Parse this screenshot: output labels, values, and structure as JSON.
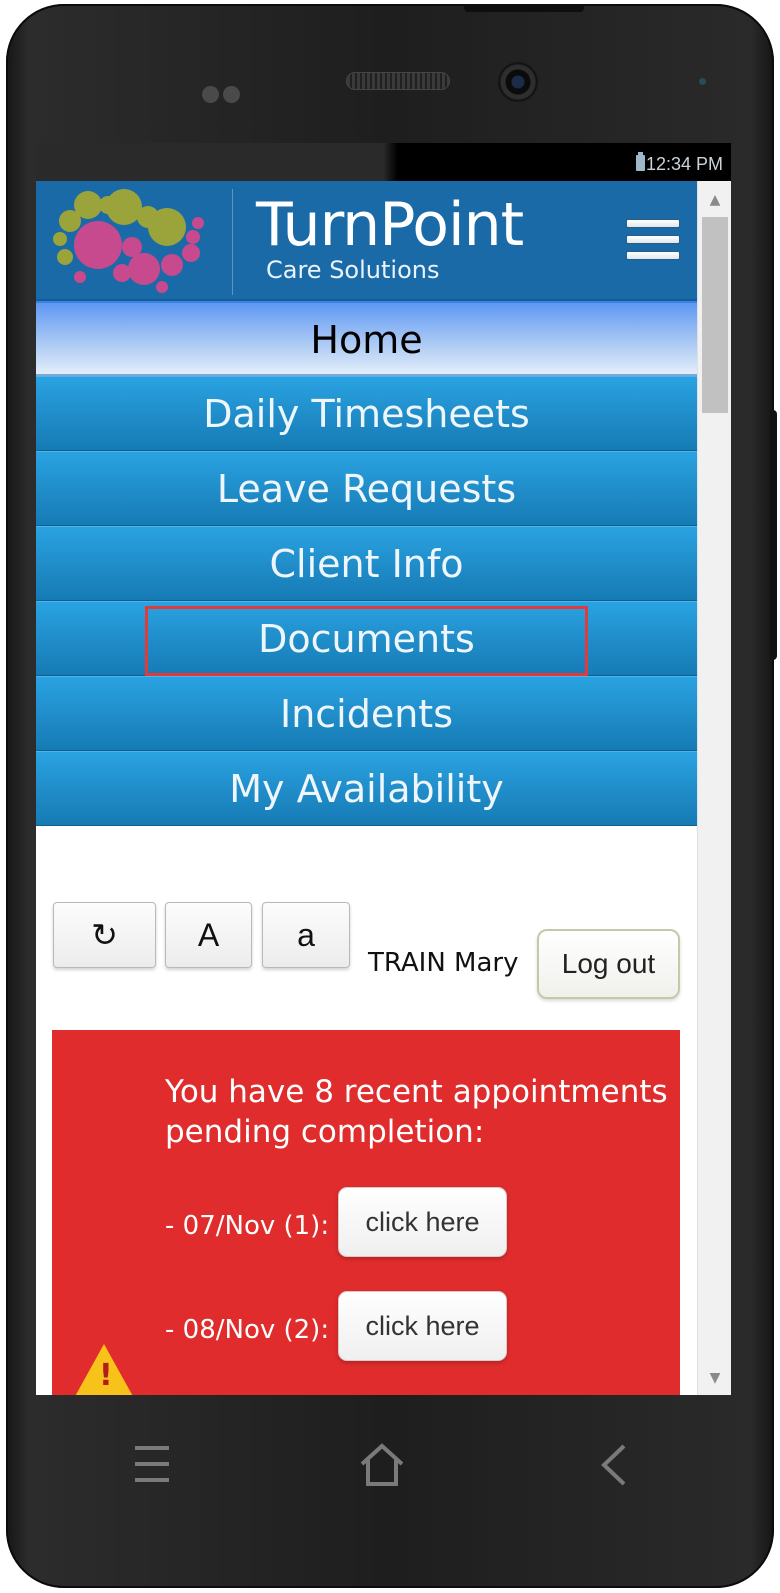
{
  "status_bar": {
    "time": "12:34 PM"
  },
  "header": {
    "brand_name": "TurnPoint",
    "brand_subtitle": "Care Solutions",
    "menu_icon": "hamburger-menu-icon",
    "color": "#1b6aa8"
  },
  "menu": {
    "items": [
      {
        "label": "Home",
        "active": true
      },
      {
        "label": "Daily Timesheets"
      },
      {
        "label": "Leave Requests"
      },
      {
        "label": "Client Info"
      },
      {
        "label": "Documents",
        "highlighted": true
      },
      {
        "label": "Incidents"
      },
      {
        "label": "My Availability"
      }
    ],
    "highlight_color": "#e03a3a"
  },
  "toolbar": {
    "refresh_icon": "refresh-icon",
    "refresh_glyph": "↻",
    "font_large_label": "A",
    "font_small_label": "a",
    "username": "TRAIN Mary",
    "logout_label": "Log out"
  },
  "alert": {
    "color": "#e02c2c",
    "message": "You have 8 recent appointments pending completion:",
    "rows": [
      {
        "label": "- 07/Nov (1):",
        "button_label": "click here"
      },
      {
        "label": "- 08/Nov (2):",
        "button_label": "click here"
      }
    ],
    "icon": "warning-icon"
  },
  "device_nav": {
    "menu_icon": "menu-icon",
    "home_icon": "home-icon",
    "back_icon": "back-icon"
  }
}
